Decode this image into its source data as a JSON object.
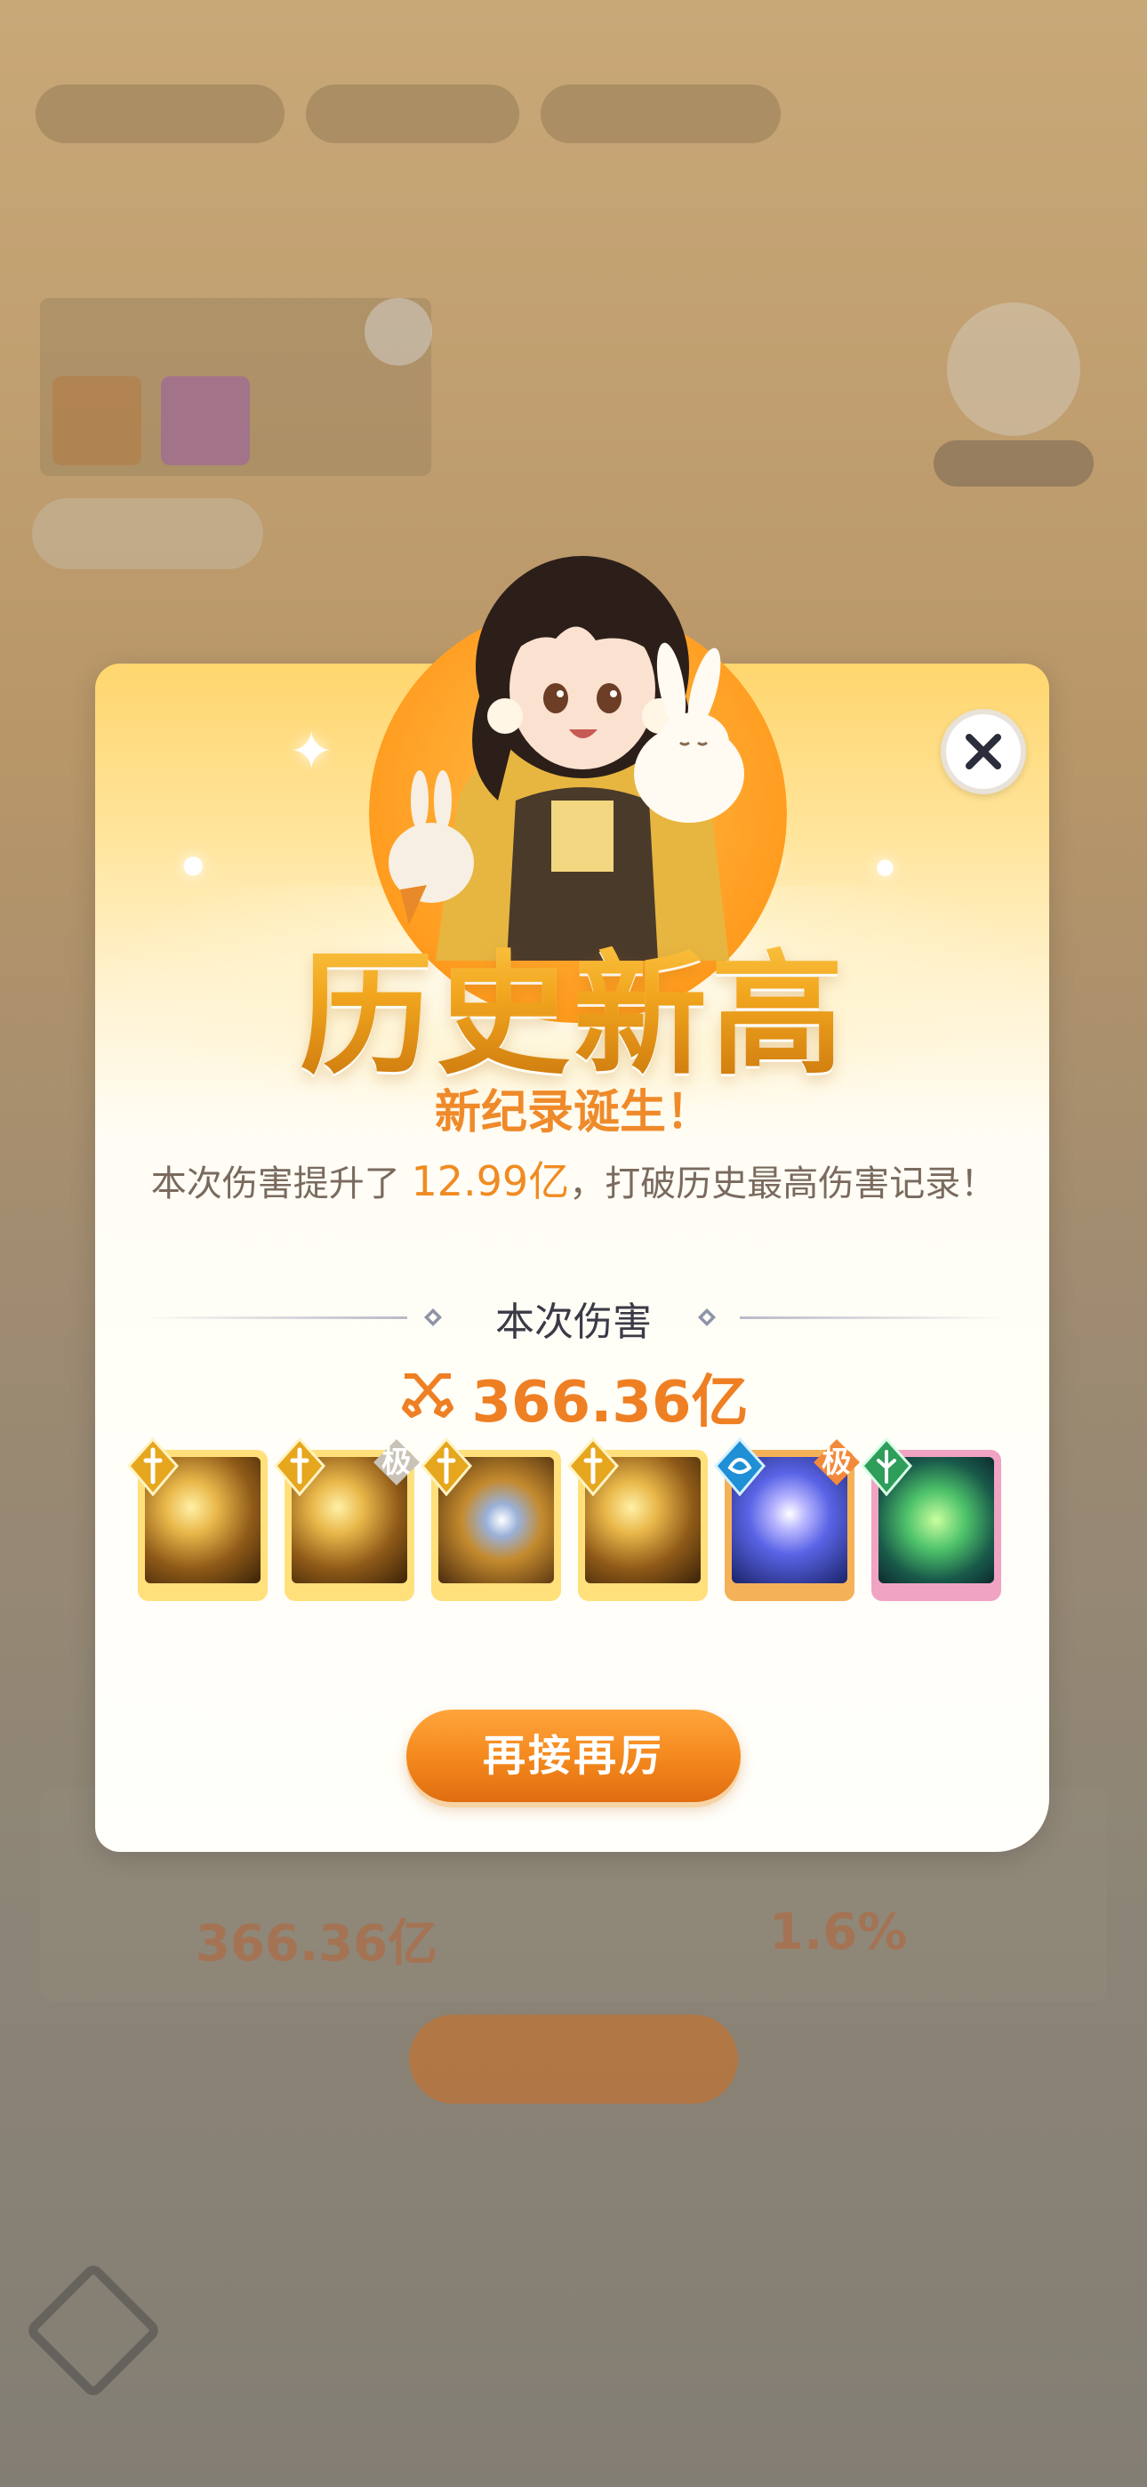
{
  "background": {
    "panel_title": "",
    "pill_label": "",
    "rank_label": "",
    "damage_value": "366.36亿",
    "percent_value": "1.6%",
    "bottom_button": ""
  },
  "popup": {
    "title": "历史新高",
    "subtitle": "新纪录诞生！",
    "desc_prefix": "本次伤害提升了 ",
    "desc_highlight": "12.99亿",
    "desc_suffix": "，打破历史最高伤害记录！",
    "section_title": "本次伤害",
    "damage_total": "366.36亿",
    "skills": [
      {
        "type": "gold",
        "element": "sword",
        "rank_badge": ""
      },
      {
        "type": "gold",
        "element": "sword",
        "rank_badge": "极"
      },
      {
        "type": "gold",
        "element": "sword",
        "rank_badge": ""
      },
      {
        "type": "gold",
        "element": "sword",
        "rank_badge": ""
      },
      {
        "type": "blue",
        "element": "water",
        "rank_badge": "极"
      },
      {
        "type": "pink",
        "element": "wood",
        "rank_badge": ""
      }
    ],
    "cta_label": "再接再厉",
    "close_icon": "close-icon"
  },
  "colors": {
    "accent": "#ef8a2a",
    "title_gold": "#e8a01a",
    "button": "#f3871c"
  }
}
